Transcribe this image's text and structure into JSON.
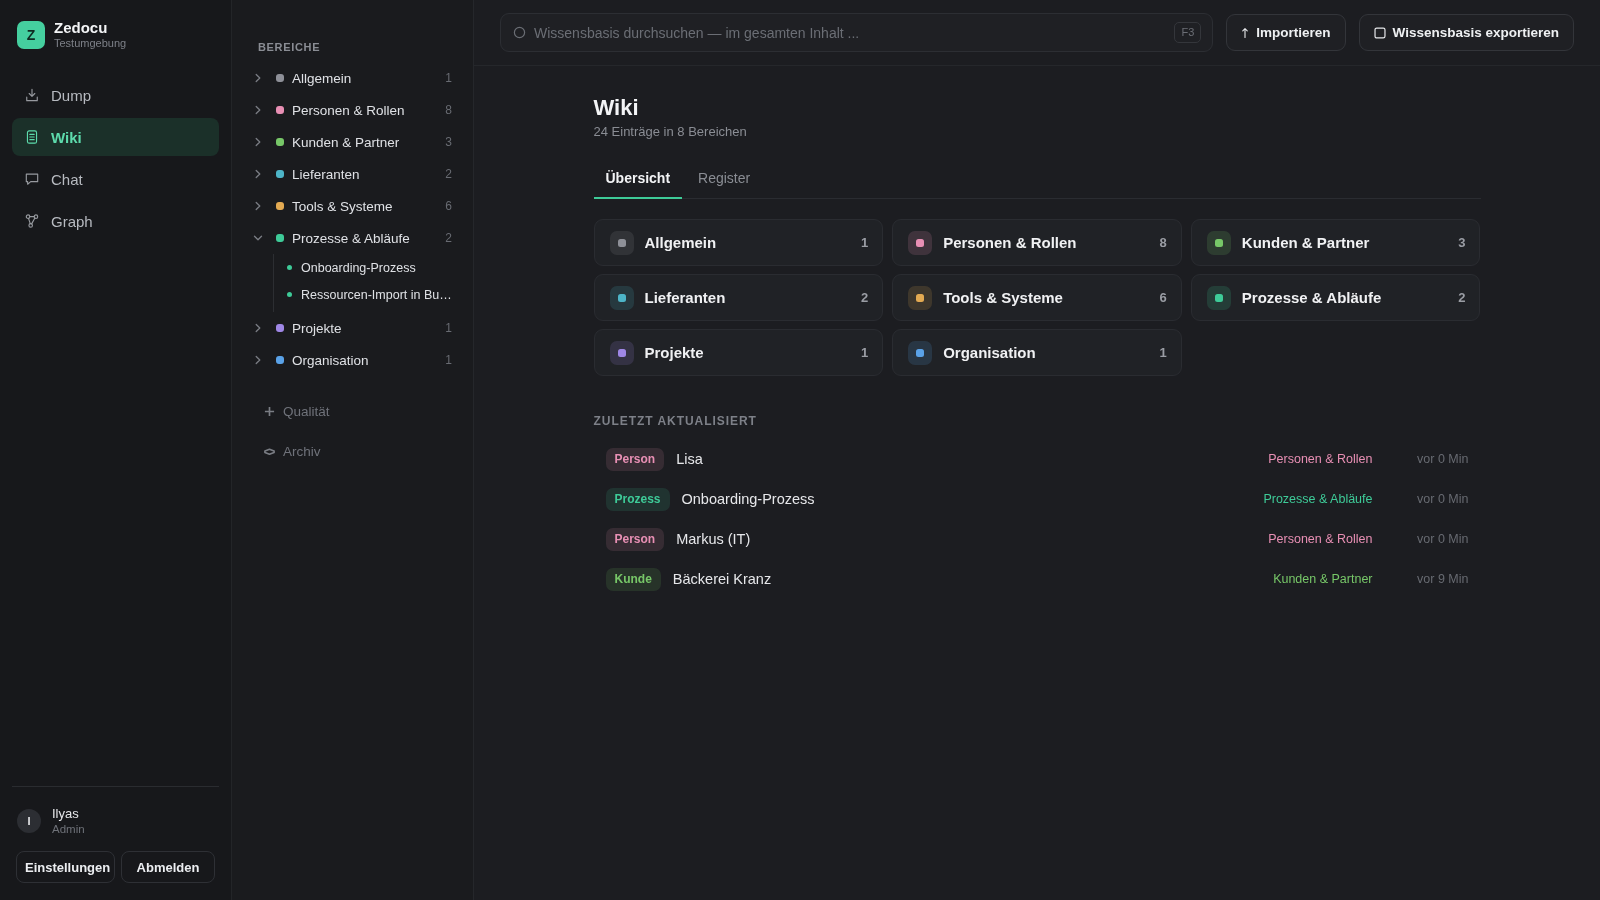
{
  "app": {
    "logo_letter": "Z",
    "name": "Zedocu",
    "environment": "Testumgebung"
  },
  "nav": [
    {
      "label": "Dump",
      "kind": "dump",
      "selected": false
    },
    {
      "label": "Wiki",
      "kind": "wiki",
      "selected": true
    },
    {
      "label": "Chat",
      "kind": "chat",
      "selected": false
    },
    {
      "label": "Graph",
      "kind": "graph",
      "selected": false
    }
  ],
  "user": {
    "initial": "I",
    "name": "Ilyas",
    "role": "Admin"
  },
  "user_actions": [
    "Einstellungen",
    "Abmelden"
  ],
  "areas_heading": "BEREICHE",
  "areas": [
    {
      "label": "Allgemein",
      "count": "1",
      "color": "#8e9098",
      "expanded": false
    },
    {
      "label": "Personen & Rollen",
      "count": "8",
      "color": "#e88fb4",
      "expanded": false
    },
    {
      "label": "Kunden & Partner",
      "count": "3",
      "color": "#77c768",
      "expanded": false
    },
    {
      "label": "Lieferanten",
      "count": "2",
      "color": "#4db5c8",
      "expanded": false
    },
    {
      "label": "Tools & Systeme",
      "count": "6",
      "color": "#e3aa52",
      "expanded": false
    },
    {
      "label": "Prozesse & Abläufe",
      "count": "2",
      "color": "#3ecb98",
      "expanded": true,
      "children": [
        {
          "label": "Onboarding-Prozess"
        },
        {
          "label": "Ressourcen-Import in Bu…"
        }
      ]
    },
    {
      "label": "Projekte",
      "count": "1",
      "color": "#9f87e6",
      "expanded": false
    },
    {
      "label": "Organisation",
      "count": "1",
      "color": "#5aa2e8",
      "expanded": false
    }
  ],
  "extras": [
    {
      "label": "Qualität",
      "kind": "add"
    },
    {
      "label": "Archiv",
      "kind": "archive"
    }
  ],
  "search": {
    "placeholder": "Wissensbasis durchsuchen — im gesamten Inhalt ...",
    "shortcut": "F3"
  },
  "actions": [
    {
      "label": "Importieren",
      "kind": "import"
    },
    {
      "label": "Wissensbasis exportieren",
      "kind": "export"
    }
  ],
  "page": {
    "title": "Wiki",
    "subtitle": "24 Einträge in 8 Bereichen"
  },
  "tabs": [
    {
      "label": "Übersicht",
      "selected": true
    },
    {
      "label": "Register",
      "selected": false
    }
  ],
  "area_cards": [
    {
      "label": "Allgemein",
      "count": "1",
      "color": "#8e9098"
    },
    {
      "label": "Personen & Rollen",
      "count": "8",
      "color": "#e88fb4"
    },
    {
      "label": "Kunden & Partner",
      "count": "3",
      "color": "#77c768"
    },
    {
      "label": "Lieferanten",
      "count": "2",
      "color": "#4db5c8"
    },
    {
      "label": "Tools & Systeme",
      "count": "6",
      "color": "#e3aa52"
    },
    {
      "label": "Prozesse & Abläufe",
      "count": "2",
      "color": "#3ecb98"
    },
    {
      "label": "Projekte",
      "count": "1",
      "color": "#9f87e6"
    },
    {
      "label": "Organisation",
      "count": "1",
      "color": "#5aa2e8"
    }
  ],
  "recent": {
    "heading": "ZULETZT AKTUALISIERT",
    "items": [
      {
        "tag": "Person",
        "title": "Lisa",
        "area": "Personen & Rollen",
        "time": "vor 0 Min",
        "color": "#e88fb4"
      },
      {
        "tag": "Prozess",
        "title": "Onboarding-Prozess",
        "area": "Prozesse & Abläufe",
        "time": "vor 0 Min",
        "color": "#3ecb98"
      },
      {
        "tag": "Person",
        "title": "Markus (IT)",
        "area": "Personen & Rollen",
        "time": "vor 0 Min",
        "color": "#e88fb4"
      },
      {
        "tag": "Kunde",
        "title": "Bäckerei Kranz",
        "area": "Kunden & Partner",
        "time": "vor 9 Min",
        "color": "#77c768"
      }
    ]
  }
}
